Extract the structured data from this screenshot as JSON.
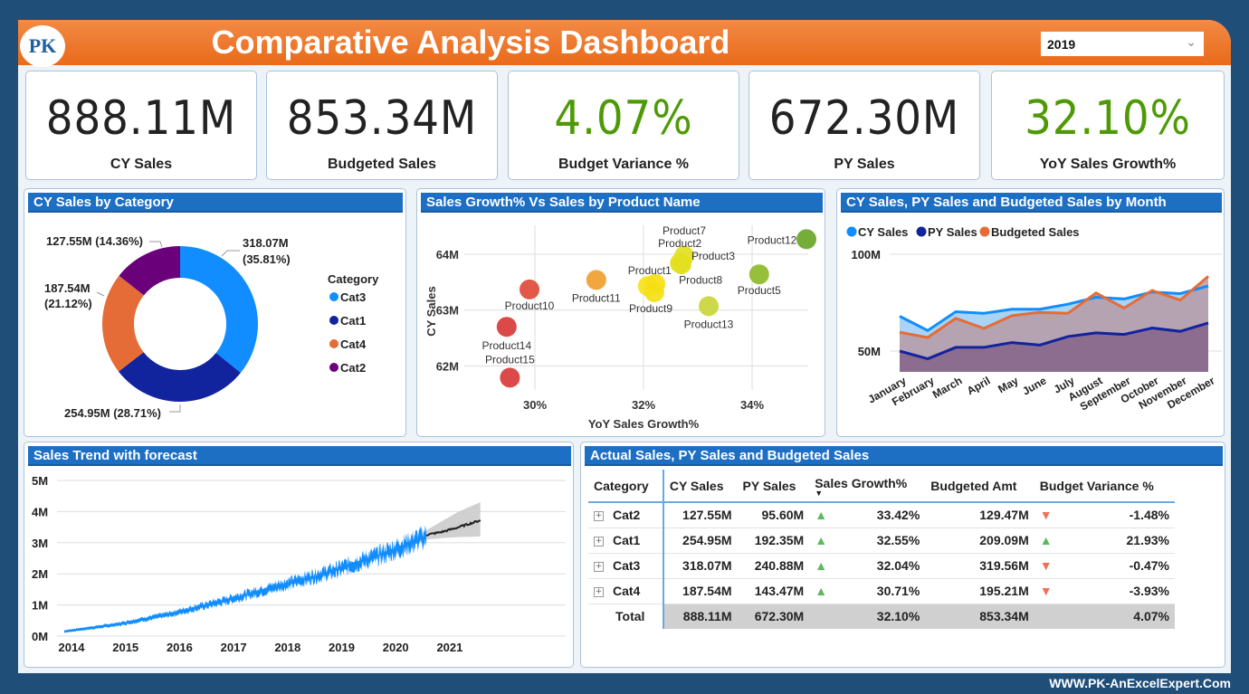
{
  "header": {
    "title": "Comparative Analysis Dashboard",
    "logo_text": "PK",
    "year_selected": "2019"
  },
  "kpis": [
    {
      "value": "888.11M",
      "label": "CY Sales",
      "highlight": false
    },
    {
      "value": "853.34M",
      "label": "Budgeted Sales",
      "highlight": false
    },
    {
      "value": "4.07%",
      "label": "Budget Variance %",
      "highlight": true
    },
    {
      "value": "672.30M",
      "label": "PY Sales",
      "highlight": false
    },
    {
      "value": "32.10%",
      "label": "YoY Sales Growth%",
      "highlight": true
    }
  ],
  "colors": {
    "accent": "#1d6fc4",
    "header": "#ef7a2c",
    "positive": "#4e9a06"
  },
  "chart_data": [
    {
      "type": "pie",
      "title": "CY Sales by Category",
      "legend_title": "Category",
      "legend_placement": "right",
      "slices": [
        {
          "name": "Cat3",
          "value": 318.07,
          "label": "318.07M",
          "pct": "(35.81%)",
          "color": "#118dff"
        },
        {
          "name": "Cat1",
          "value": 254.95,
          "label": "254.95M",
          "pct": "(28.71%)",
          "color": "#12239e"
        },
        {
          "name": "Cat4",
          "value": 187.54,
          "label": "187.54M",
          "pct": "(21.12%)",
          "color": "#e66c37"
        },
        {
          "name": "Cat2",
          "value": 127.55,
          "label": "127.55M",
          "pct": "(14.36%)",
          "color": "#6b007b"
        }
      ]
    },
    {
      "type": "scatter",
      "title": "Sales Growth% Vs Sales by Product Name",
      "xlabel": "YoY Sales Growth%",
      "ylabel": "CY Sales",
      "xticks": [
        "30%",
        "32%",
        "34%"
      ],
      "yticks": [
        "64M",
        "63M",
        "62M"
      ],
      "points": [
        {
          "name": "Product10",
          "x": 29.9,
          "y": 63.37,
          "color": "#dd4b39"
        },
        {
          "name": "Product11",
          "x": 31.13,
          "y": 63.54,
          "color": "#efa030"
        },
        {
          "name": "Product14",
          "x": 29.48,
          "y": 62.7,
          "color": "#d93a3a"
        },
        {
          "name": "Product15",
          "x": 29.54,
          "y": 61.79,
          "color": "#d93a3a"
        },
        {
          "name": "Product1",
          "x": 32.08,
          "y": 63.43,
          "color": "#f7e21a"
        },
        {
          "name": "Product9",
          "x": 32.2,
          "y": 63.32,
          "color": "#f5e016"
        },
        {
          "name": "Product8",
          "x": 32.22,
          "y": 63.47,
          "color": "#f5e016"
        },
        {
          "name": "Product2",
          "x": 32.67,
          "y": 63.84,
          "color": "#e3e020"
        },
        {
          "name": "Product7",
          "x": 32.75,
          "y": 63.97,
          "color": "#e3e020"
        },
        {
          "name": "Product3",
          "x": 32.7,
          "y": 63.82,
          "color": "#e3e020"
        },
        {
          "name": "Product13",
          "x": 33.2,
          "y": 63.07,
          "color": "#c9d63a"
        },
        {
          "name": "Product5",
          "x": 34.13,
          "y": 63.64,
          "color": "#8dbb2a"
        },
        {
          "name": "Product12",
          "x": 35.0,
          "y": 64.27,
          "color": "#6aa628"
        }
      ]
    },
    {
      "type": "area",
      "title": "CY Sales, PY Sales and Budgeted Sales by Month",
      "legend_placement": "top-left",
      "categories": [
        "January",
        "February",
        "March",
        "April",
        "May",
        "June",
        "July",
        "August",
        "September",
        "October",
        "November",
        "December"
      ],
      "yticks": [
        "100M",
        "50M"
      ],
      "series": [
        {
          "name": "CY Sales",
          "color": "#118dff",
          "values": [
            68,
            60.6,
            70.3,
            69.5,
            71.6,
            71.6,
            74.2,
            77.8,
            76.9,
            80.5,
            79.7,
            83.6
          ]
        },
        {
          "name": "PY Sales",
          "color": "#12239e",
          "values": [
            50,
            46,
            51.9,
            51.9,
            54.4,
            53.1,
            57.5,
            59.4,
            58.6,
            61.9,
            60.2,
            64.5
          ]
        },
        {
          "name": "Budgeted Sales",
          "color": "#e66c37",
          "values": [
            59.7,
            57,
            66.9,
            61.7,
            68.3,
            70,
            69.5,
            80,
            72.2,
            81.3,
            76.3,
            88.6
          ]
        }
      ]
    },
    {
      "type": "line",
      "title": "Sales Trend with forecast",
      "yticks": [
        "5M",
        "4M",
        "3M",
        "2M",
        "1M",
        "0M"
      ],
      "xticks": [
        "2014",
        "2015",
        "2016",
        "2017",
        "2018",
        "2019",
        "2020",
        "2021"
      ],
      "actual": {
        "color": "#118dff",
        "x": [
          2014,
          2015,
          2016,
          2017,
          2018,
          2019,
          2020,
          2020.7
        ],
        "y": [
          0.15,
          0.38,
          0.72,
          1.15,
          1.62,
          2.1,
          2.7,
          3.2
        ]
      },
      "forecast": {
        "color": "#222222",
        "band_color": "#d0d0d0",
        "x": [
          2020.7,
          2021,
          2021.3,
          2021.7
        ],
        "y": [
          3.25,
          3.35,
          3.5,
          3.72
        ],
        "lower": [
          3.1,
          3.15,
          3.18,
          3.2
        ],
        "upper": [
          3.4,
          3.7,
          4.0,
          4.3
        ]
      }
    }
  ],
  "table": {
    "title": "Actual Sales, PY Sales and Budgeted Sales",
    "columns": [
      "Category",
      "CY Sales",
      "PY Sales",
      "Sales Growth%",
      "Budgeted Amt",
      "Budget Variance %"
    ],
    "rows": [
      {
        "cat": "Cat2",
        "cy": "127.55M",
        "py": "95.60M",
        "g_dir": "up",
        "g": "33.42%",
        "b": "129.47M",
        "v_dir": "down",
        "v": "-1.48%"
      },
      {
        "cat": "Cat1",
        "cy": "254.95M",
        "py": "192.35M",
        "g_dir": "up",
        "g": "32.55%",
        "b": "209.09M",
        "v_dir": "up",
        "v": "21.93%"
      },
      {
        "cat": "Cat3",
        "cy": "318.07M",
        "py": "240.88M",
        "g_dir": "up",
        "g": "32.04%",
        "b": "319.56M",
        "v_dir": "down",
        "v": "-0.47%"
      },
      {
        "cat": "Cat4",
        "cy": "187.54M",
        "py": "143.47M",
        "g_dir": "up",
        "g": "30.71%",
        "b": "195.21M",
        "v_dir": "down",
        "v": "-3.93%"
      }
    ],
    "total": {
      "cat": "Total",
      "cy": "888.11M",
      "py": "672.30M",
      "g": "32.10%",
      "b": "853.34M",
      "v": "4.07%"
    }
  },
  "footer": "WWW.PK-AnExcelExpert.Com"
}
